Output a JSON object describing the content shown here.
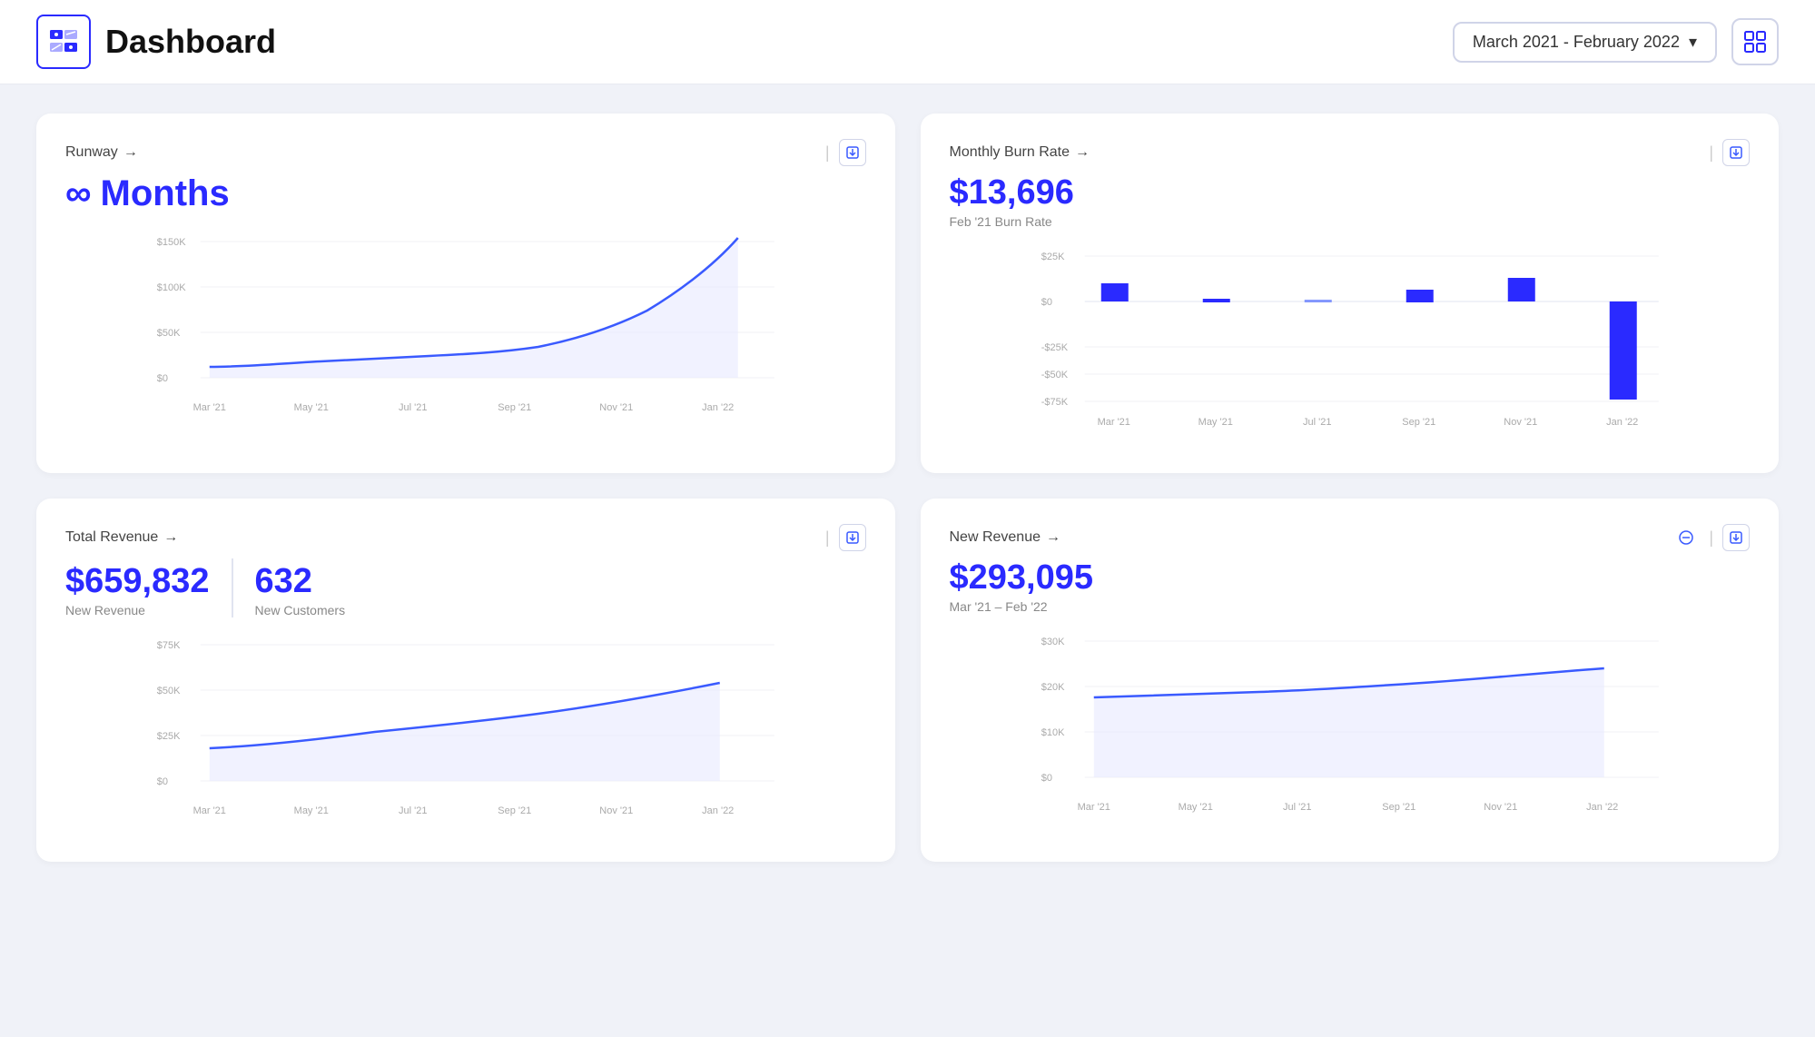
{
  "header": {
    "title": "Dashboard",
    "date_range": "March 2021 - February 2022",
    "date_range_short": "March 2021 – February 2022"
  },
  "cards": {
    "runway": {
      "title": "Runway",
      "value": "∞ Months",
      "infinity_symbol": "∞",
      "months_label": "Months",
      "x_labels": [
        "Mar '21",
        "May '21",
        "Jul '21",
        "Sep '21",
        "Nov '21",
        "Jan '22"
      ],
      "y_labels": [
        "$150K",
        "$100K",
        "$50K",
        "$0"
      ]
    },
    "burn_rate": {
      "title": "Monthly Burn Rate",
      "value": "$13,696",
      "sub_label": "Feb '21 Burn Rate",
      "x_labels": [
        "Mar '21",
        "May '21",
        "Jul '21",
        "Sep '21",
        "Nov '21",
        "Jan '22"
      ],
      "y_labels": [
        "$25K",
        "$0",
        "-$25K",
        "-$50K",
        "-$75K"
      ]
    },
    "total_revenue": {
      "title": "Total Revenue",
      "metric1_value": "$659,832",
      "metric1_label": "New Revenue",
      "metric2_value": "632",
      "metric2_label": "New Customers",
      "x_labels": [
        "Mar '21",
        "May '21",
        "Jul '21",
        "Sep '21",
        "Nov '21",
        "Jan '22"
      ],
      "y_labels": [
        "$75K",
        "$50K",
        "$25K",
        "$0"
      ]
    },
    "new_revenue": {
      "title": "New Revenue",
      "value": "$293,095",
      "sub_label": "Mar '21 – Feb '22",
      "x_labels": [
        "Mar '21",
        "May '21",
        "Jul '21",
        "Sep '21",
        "Nov '21",
        "Jan '22"
      ],
      "y_labels": [
        "$30K",
        "$20K",
        "$10K",
        "$0"
      ]
    }
  },
  "icons": {
    "arrow_right": "→",
    "infinity": "∞",
    "chevron_down": "▾",
    "download": "⬇",
    "grid": "⊞",
    "circle_minus": "⊖"
  },
  "colors": {
    "primary_blue": "#2a2aff",
    "light_blue": "#4d7cfe",
    "chart_fill": "#e8ecff",
    "chart_line": "#3a5aff",
    "bar_blue": "#2a2aff"
  }
}
